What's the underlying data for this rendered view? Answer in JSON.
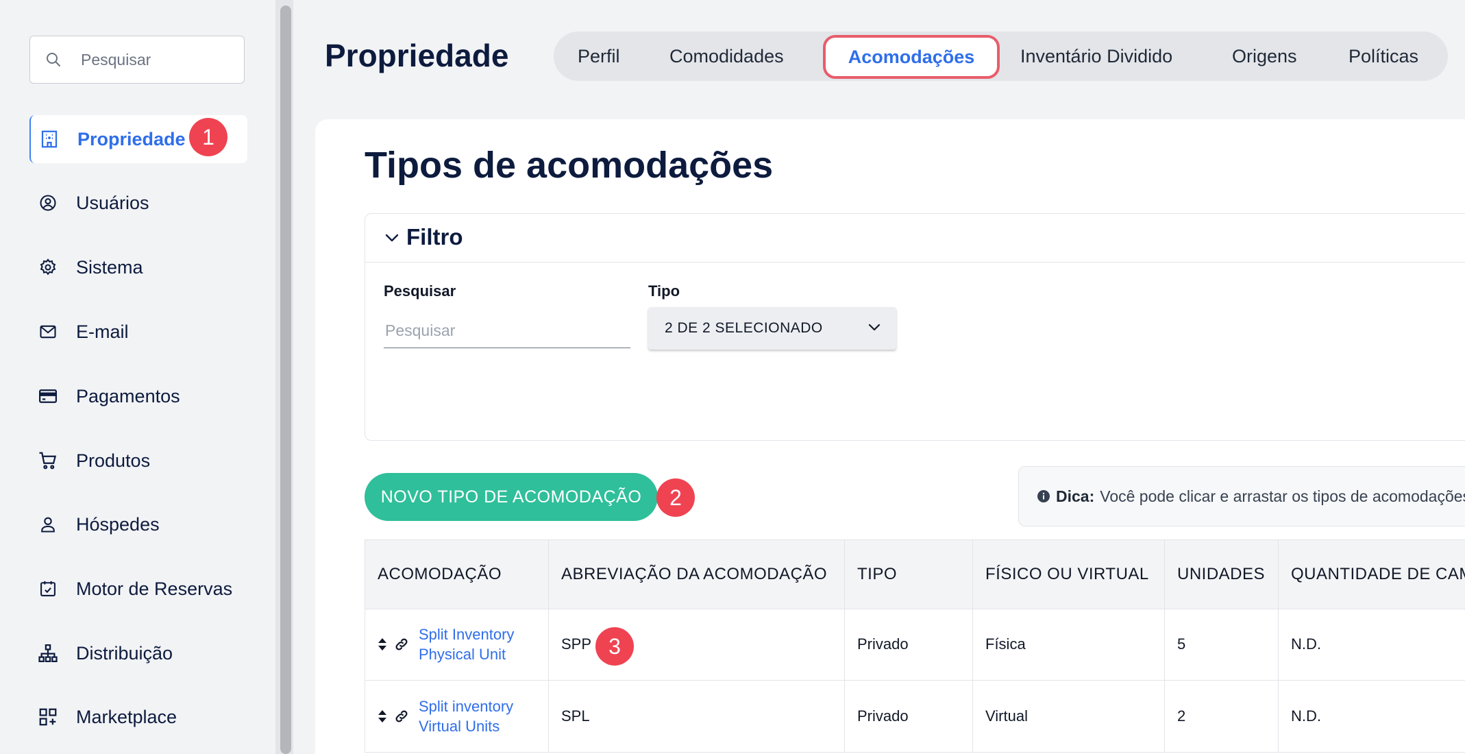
{
  "sidebar": {
    "search_placeholder": "Pesquisar",
    "items": [
      {
        "label": "Propriedade",
        "icon": "building-icon",
        "active": true,
        "badge": "1"
      },
      {
        "label": "Usuários",
        "icon": "user-circle-icon"
      },
      {
        "label": "Sistema",
        "icon": "gear-icon"
      },
      {
        "label": "E-mail",
        "icon": "envelope-icon"
      },
      {
        "label": "Pagamentos",
        "icon": "credit-card-icon"
      },
      {
        "label": "Produtos",
        "icon": "cart-icon"
      },
      {
        "label": "Hóspedes",
        "icon": "person-icon"
      },
      {
        "label": "Motor de Reservas",
        "icon": "calendar-check-icon"
      },
      {
        "label": "Distribuição",
        "icon": "sitemap-icon"
      },
      {
        "label": "Marketplace",
        "icon": "grid-plus-icon"
      }
    ]
  },
  "header": {
    "title": "Propriedade",
    "tabs": [
      {
        "label": "Perfil"
      },
      {
        "label": "Comodidades"
      },
      {
        "label": "Acomodações",
        "active": true
      },
      {
        "label": "Inventário Dividido"
      },
      {
        "label": "Origens"
      },
      {
        "label": "Políticas"
      }
    ]
  },
  "main": {
    "title": "Tipos de acomodações",
    "filter": {
      "title": "Filtro",
      "search_label": "Pesquisar",
      "search_placeholder": "Pesquisar",
      "type_label": "Tipo",
      "type_value": "2 DE 2 SELECIONADO"
    },
    "new_button": "NOVO TIPO DE ACOMODAÇÃO",
    "new_badge": "2",
    "tip_label": "Dica:",
    "tip_text": "Você pode clicar e arrastar os tipos de acomodações",
    "table": {
      "headers": [
        "ACOMODAÇÃO",
        "ABREVIAÇÃO DA ACOMODAÇÃO",
        "TIPO",
        "FÍSICO OU VIRTUAL",
        "UNIDADES",
        "QUANTIDADE DE CAMAS"
      ],
      "rows": [
        {
          "name": "Split Inventory Physical Unit",
          "abbr": "SPP",
          "type": "Privado",
          "kind": "Física",
          "units": "5",
          "beds": "N.D."
        },
        {
          "name": "Split inventory Virtual Units",
          "abbr": "SPL",
          "type": "Privado",
          "kind": "Virtual",
          "units": "2",
          "beds": "N.D."
        }
      ],
      "row_badge": "3"
    }
  },
  "colors": {
    "accent": "#2f6ee9",
    "badge": "#ef4352",
    "primary_button": "#2fbf9a",
    "title": "#0d1b3e"
  }
}
